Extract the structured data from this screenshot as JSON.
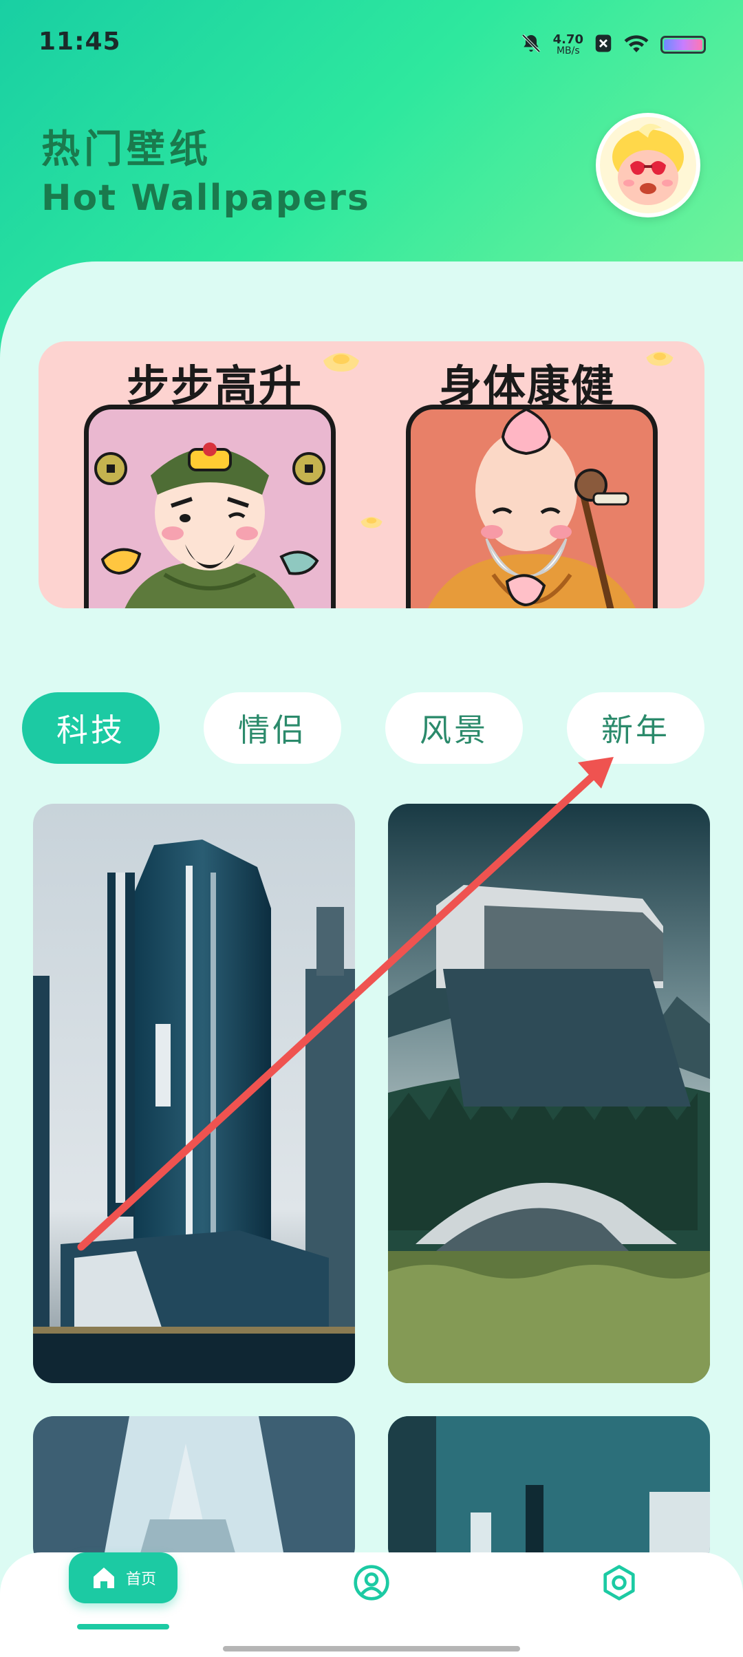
{
  "status_bar": {
    "time": "11:45",
    "net_speed_value": "4.70",
    "net_speed_unit": "MB/s",
    "icons": [
      "bell-muted-icon",
      "close-box-icon",
      "wifi-icon",
      "battery-icon"
    ]
  },
  "header": {
    "title_cn": "热门壁纸",
    "title_en": "Hot Wallpapers",
    "avatar_icon": "cartoon-avatar"
  },
  "banner": {
    "left_caption": "步步高升",
    "right_caption": "身体康健",
    "background_color": "#fdd3d0"
  },
  "tabs": [
    {
      "label": "科技",
      "active": true
    },
    {
      "label": "情侣",
      "active": false
    },
    {
      "label": "风景",
      "active": false
    },
    {
      "label": "新年",
      "active": false
    }
  ],
  "wallpapers": [
    {
      "icon": "futuristic-skyscraper-image"
    },
    {
      "icon": "mountain-futuristic-building-image"
    },
    {
      "icon": "glass-tower-image"
    },
    {
      "icon": "teal-city-image"
    }
  ],
  "bottom_nav": {
    "home_label": "首页",
    "items": [
      "home-icon",
      "profile-icon",
      "settings-icon"
    ]
  },
  "colors": {
    "accent": "#1ccaa3",
    "title": "#1a7a4d",
    "background": "#dcfbf3",
    "arrow": "#ef5350"
  }
}
